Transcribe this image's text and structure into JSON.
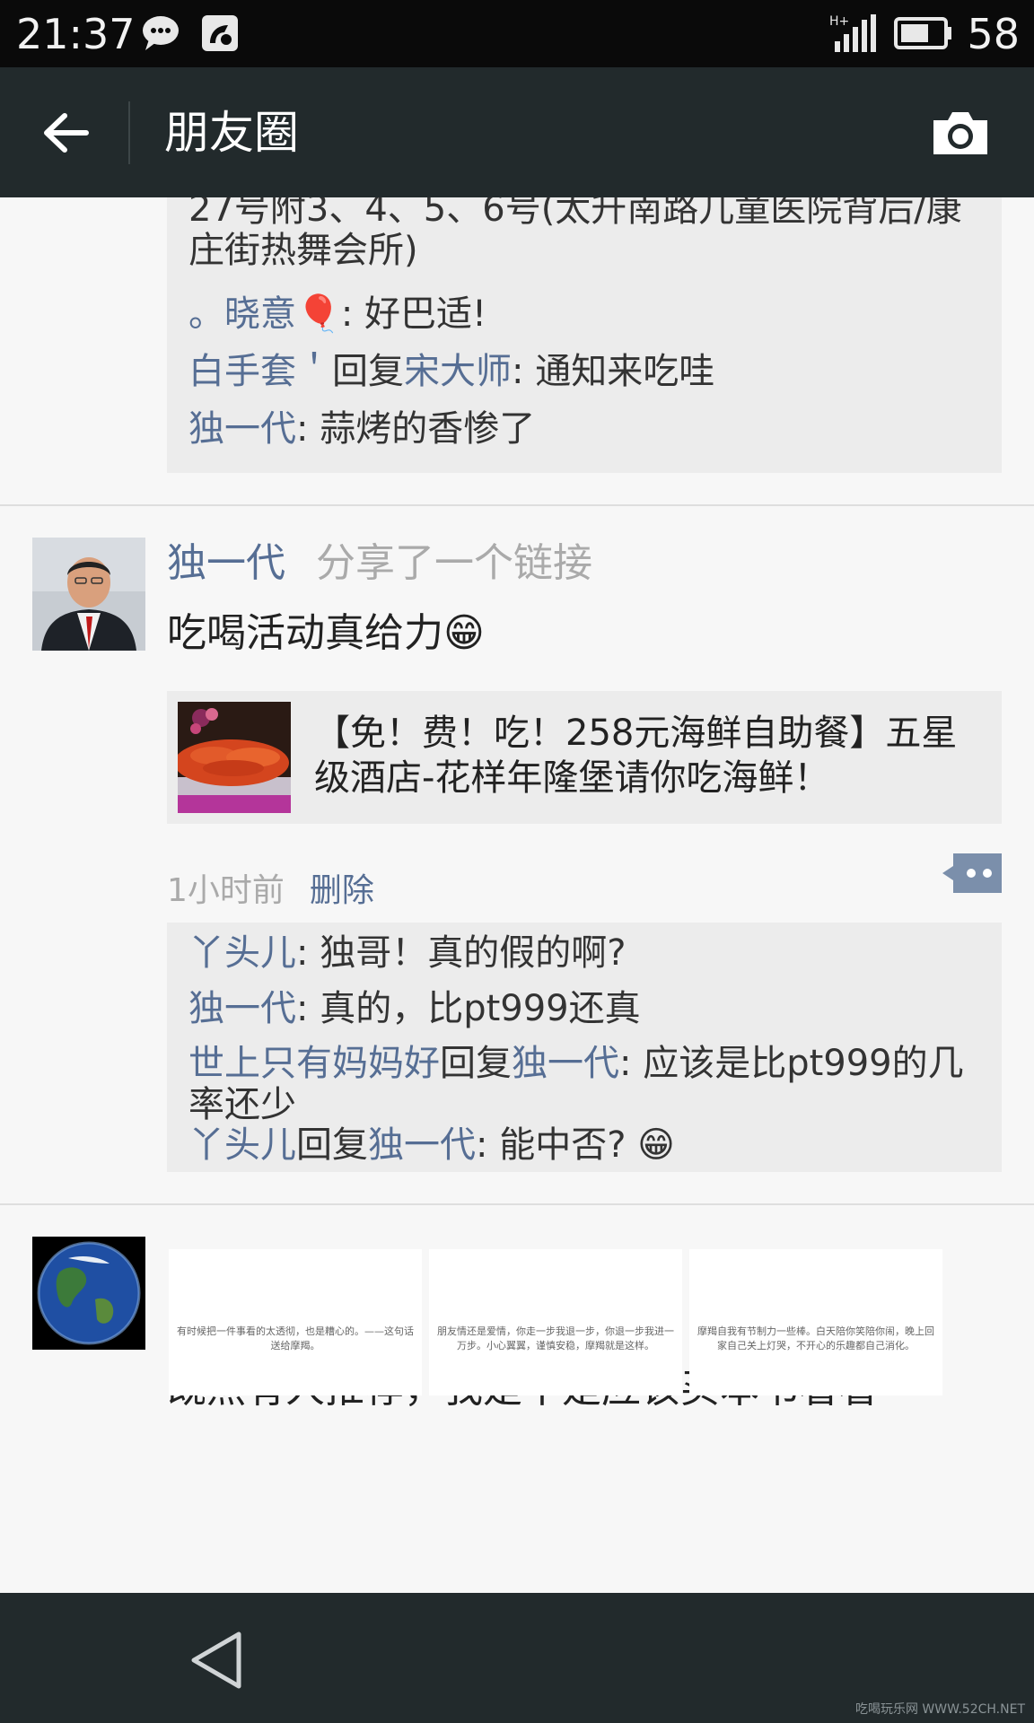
{
  "status_bar": {
    "time": "21:37",
    "battery_percent": "58"
  },
  "app_bar": {
    "title": "朋友圈"
  },
  "post1": {
    "continued_location": "27号附3、4、5、6号(太升南路儿童医院背后/康庄街热舞会所)",
    "comments": [
      {
        "name": "。晓意",
        "emoji": "🎈",
        "sep": ": ",
        "text": "好巴适!"
      },
      {
        "name": "白手套＇",
        "reply_word": "回复",
        "reply_to": "宋大师",
        "sep": ": ",
        "text": "通知来吃哇"
      },
      {
        "name": "独一代",
        "sep": ": ",
        "text": "蒜烤的香惨了"
      }
    ]
  },
  "post2": {
    "user": "独一代",
    "action": "分享了一个链接",
    "text": "吃喝活动真给力",
    "emoji": "😁",
    "link_title": "【免！费！吃！258元海鲜自助餐】五星级酒店-花样年隆堡请你吃海鲜！",
    "time_ago": "1小时前",
    "delete_label": "删除",
    "comments": [
      {
        "name": "丫头儿",
        "sep": ": ",
        "text": "独哥！真的假的啊?"
      },
      {
        "name": "独一代",
        "sep": ": ",
        "text": "真的，比pt999还真"
      },
      {
        "name": "世上只有妈妈好",
        "reply_word": "回复",
        "reply_to": "独一代",
        "sep": ": ",
        "text": "应该是比pt999的几率还少"
      },
      {
        "name": "丫头儿",
        "reply_word": "回复",
        "reply_to": "独一代",
        "sep": ": ",
        "text": "能中否? ",
        "emoji": "😁"
      }
    ]
  },
  "post3": {
    "user_emojis": "☀️☔☁️⛄",
    "text": "既然有人推荐，我是不是应该买本书看看",
    "photos": [
      {
        "text": "有时候把一件事看的太透彻，也是糟心的。——这句话送给摩羯。"
      },
      {
        "text": "朋友情还是爱情，你走一步我退一步，你退一步我进一万步。小心翼翼，谨慎安稳，摩羯就是这样。"
      },
      {
        "text": "摩羯自我有节制力一些棒。白天陪你笑陪你闹，晚上回家自己关上灯哭，不开心的乐趣都自己消化。"
      }
    ]
  },
  "watermark": "吃喝玩乐网 WWW.52CH.NET",
  "colors": {
    "name_blue": "#566e94",
    "app_bar_bg": "#222a2c",
    "comment_bg": "#ececec"
  }
}
